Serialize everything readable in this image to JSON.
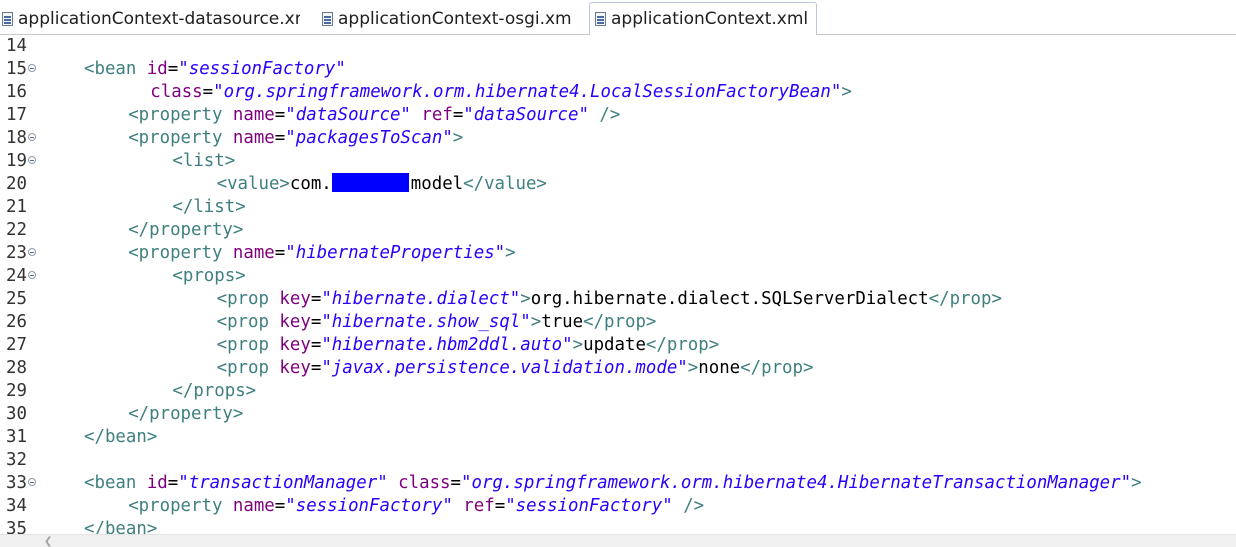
{
  "tabs": [
    {
      "label": "applicationContext-datasource.xml",
      "active": false
    },
    {
      "label": "applicationContext-osgi.xml",
      "active": false
    },
    {
      "label": "applicationContext.xml",
      "active": true,
      "close": "✕"
    }
  ],
  "icons": {
    "tab_file": "xml-file-icon",
    "fold": "fold-collapse-icon",
    "scroll_left": "scroll-left-arrow-icon"
  },
  "colors": {
    "tag": "#3f7f7f",
    "attr": "#7f007f",
    "value": "#2a00ff",
    "redaction": "#0000ff"
  },
  "lines": [
    {
      "n": "14",
      "fold": false,
      "indent": 0,
      "parts": []
    },
    {
      "n": "15",
      "fold": true,
      "indent": 0,
      "parts": [
        [
          "tag",
          "<bean "
        ],
        [
          "attr",
          "id"
        ],
        [
          "eq",
          "="
        ],
        [
          "val",
          "\"sessionFactory\""
        ]
      ]
    },
    {
      "n": "16",
      "fold": false,
      "indent": 6,
      "parts": [
        [
          "attr",
          "class"
        ],
        [
          "eq",
          "="
        ],
        [
          "val",
          "\"org.springframework.orm.hibernate4.LocalSessionFactoryBean\""
        ],
        [
          "tag",
          ">"
        ]
      ]
    },
    {
      "n": "17",
      "fold": false,
      "indent": 4,
      "parts": [
        [
          "tag",
          "<property "
        ],
        [
          "attr",
          "name"
        ],
        [
          "eq",
          "="
        ],
        [
          "val",
          "\"dataSource\""
        ],
        [
          "txt",
          " "
        ],
        [
          "attr",
          "ref"
        ],
        [
          "eq",
          "="
        ],
        [
          "val",
          "\"dataSource\""
        ],
        [
          "txt",
          " "
        ],
        [
          "tag",
          "/>"
        ]
      ]
    },
    {
      "n": "18",
      "fold": true,
      "indent": 4,
      "parts": [
        [
          "tag",
          "<property "
        ],
        [
          "attr",
          "name"
        ],
        [
          "eq",
          "="
        ],
        [
          "val",
          "\"packagesToScan\""
        ],
        [
          "tag",
          ">"
        ]
      ]
    },
    {
      "n": "19",
      "fold": true,
      "indent": 8,
      "parts": [
        [
          "tag",
          "<list>"
        ]
      ]
    },
    {
      "n": "20",
      "fold": false,
      "indent": 12,
      "parts": [
        [
          "tag",
          "<value>"
        ],
        [
          "txt",
          "com."
        ],
        [
          "redact",
          ""
        ],
        [
          "txt",
          "model"
        ],
        [
          "tag",
          "</value>"
        ]
      ]
    },
    {
      "n": "21",
      "fold": false,
      "indent": 8,
      "parts": [
        [
          "tag",
          "</list>"
        ]
      ]
    },
    {
      "n": "22",
      "fold": false,
      "indent": 4,
      "parts": [
        [
          "tag",
          "</property>"
        ]
      ]
    },
    {
      "n": "23",
      "fold": true,
      "indent": 4,
      "parts": [
        [
          "tag",
          "<property "
        ],
        [
          "attr",
          "name"
        ],
        [
          "eq",
          "="
        ],
        [
          "val",
          "\"hibernateProperties\""
        ],
        [
          "tag",
          ">"
        ]
      ]
    },
    {
      "n": "24",
      "fold": true,
      "indent": 8,
      "parts": [
        [
          "tag",
          "<props>"
        ]
      ]
    },
    {
      "n": "25",
      "fold": false,
      "indent": 12,
      "parts": [
        [
          "tag",
          "<prop "
        ],
        [
          "attr",
          "key"
        ],
        [
          "eq",
          "="
        ],
        [
          "val",
          "\"hibernate.dialect\""
        ],
        [
          "tag",
          ">"
        ],
        [
          "txt",
          "org.hibernate.dialect.SQLServerDialect"
        ],
        [
          "tag",
          "</prop>"
        ]
      ]
    },
    {
      "n": "26",
      "fold": false,
      "indent": 12,
      "parts": [
        [
          "tag",
          "<prop "
        ],
        [
          "attr",
          "key"
        ],
        [
          "eq",
          "="
        ],
        [
          "val",
          "\"hibernate.show_sql\""
        ],
        [
          "tag",
          ">"
        ],
        [
          "txt",
          "true"
        ],
        [
          "tag",
          "</prop>"
        ]
      ]
    },
    {
      "n": "27",
      "fold": false,
      "indent": 12,
      "parts": [
        [
          "tag",
          "<prop "
        ],
        [
          "attr",
          "key"
        ],
        [
          "eq",
          "="
        ],
        [
          "val",
          "\"hibernate.hbm2ddl.auto\""
        ],
        [
          "tag",
          ">"
        ],
        [
          "txt",
          "update"
        ],
        [
          "tag",
          "</prop>"
        ]
      ]
    },
    {
      "n": "28",
      "fold": false,
      "indent": 12,
      "parts": [
        [
          "tag",
          "<prop "
        ],
        [
          "attr",
          "key"
        ],
        [
          "eq",
          "="
        ],
        [
          "val",
          "\"javax.persistence.validation.mode\""
        ],
        [
          "tag",
          ">"
        ],
        [
          "txt",
          "none"
        ],
        [
          "tag",
          "</prop>"
        ]
      ]
    },
    {
      "n": "29",
      "fold": false,
      "indent": 8,
      "parts": [
        [
          "tag",
          "</props>"
        ]
      ]
    },
    {
      "n": "30",
      "fold": false,
      "indent": 4,
      "parts": [
        [
          "tag",
          "</property>"
        ]
      ]
    },
    {
      "n": "31",
      "fold": false,
      "indent": 0,
      "parts": [
        [
          "tag",
          "</bean>"
        ]
      ]
    },
    {
      "n": "32",
      "fold": false,
      "indent": 0,
      "parts": []
    },
    {
      "n": "33",
      "fold": true,
      "indent": 0,
      "parts": [
        [
          "tag",
          "<bean "
        ],
        [
          "attr",
          "id"
        ],
        [
          "eq",
          "="
        ],
        [
          "val",
          "\"transactionManager\""
        ],
        [
          "txt",
          " "
        ],
        [
          "attr",
          "class"
        ],
        [
          "eq",
          "="
        ],
        [
          "val",
          "\"org.springframework.orm.hibernate4.HibernateTransactionManager\""
        ],
        [
          "tag",
          ">"
        ]
      ]
    },
    {
      "n": "34",
      "fold": false,
      "indent": 4,
      "parts": [
        [
          "tag",
          "<property "
        ],
        [
          "attr",
          "name"
        ],
        [
          "eq",
          "="
        ],
        [
          "val",
          "\"sessionFactory\""
        ],
        [
          "txt",
          " "
        ],
        [
          "attr",
          "ref"
        ],
        [
          "eq",
          "="
        ],
        [
          "val",
          "\"sessionFactory\""
        ],
        [
          "txt",
          " "
        ],
        [
          "tag",
          "/>"
        ]
      ]
    },
    {
      "n": "35",
      "fold": false,
      "indent": 0,
      "parts": [
        [
          "tag",
          "</bean>"
        ]
      ]
    }
  ]
}
